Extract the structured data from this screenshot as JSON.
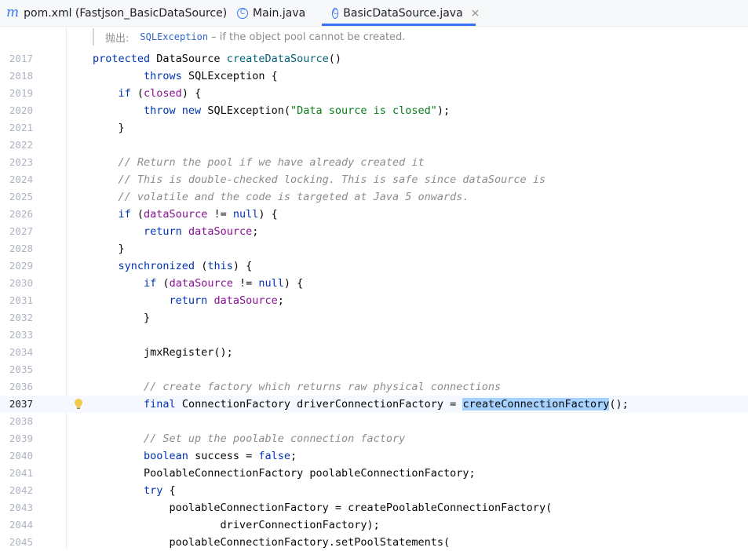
{
  "tabs": [
    {
      "label": "pom.xml (Fastjson_BasicDataSource)",
      "icon": "maven-icon",
      "active": false
    },
    {
      "label": "Main.java",
      "icon": "class-icon",
      "active": false
    },
    {
      "label": "BasicDataSource.java",
      "icon": "class-icon",
      "active": true
    }
  ],
  "close_glyph": "×",
  "doc_hint": {
    "label": "抛出:",
    "link": "SQLException",
    "text": "– if the object pool cannot be created."
  },
  "current_line": "2037",
  "lines": [
    {
      "num": "2017",
      "tokens": [
        [
          "kw",
          "protected"
        ],
        [
          "",
          "DataSource "
        ],
        [
          "mth",
          "createDataSource"
        ],
        [
          "",
          "()"
        ]
      ]
    },
    {
      "num": "2018",
      "tokens": [
        [
          "",
          "        "
        ],
        [
          "kw",
          "throws"
        ],
        [
          "",
          "SQLException {"
        ]
      ]
    },
    {
      "num": "2019",
      "tokens": [
        [
          "",
          "    "
        ],
        [
          "kw",
          "if"
        ],
        [
          "",
          "("
        ],
        [
          "fld",
          "closed"
        ],
        [
          "",
          ") {"
        ]
      ]
    },
    {
      "num": "2020",
      "tokens": [
        [
          "",
          "        "
        ],
        [
          "kw",
          "throw new"
        ],
        [
          "",
          "SQLException("
        ],
        [
          "str",
          "\"Data source is closed\""
        ],
        [
          "",
          ");"
        ]
      ]
    },
    {
      "num": "2021",
      "tokens": [
        [
          "",
          "    }"
        ]
      ]
    },
    {
      "num": "2022",
      "tokens": []
    },
    {
      "num": "2023",
      "tokens": [
        [
          "",
          "    "
        ],
        [
          "cmt",
          "// Return the pool if we have already created it"
        ]
      ]
    },
    {
      "num": "2024",
      "tokens": [
        [
          "",
          "    "
        ],
        [
          "cmt",
          "// This is double-checked locking. This is safe since dataSource is"
        ]
      ]
    },
    {
      "num": "2025",
      "tokens": [
        [
          "",
          "    "
        ],
        [
          "cmt",
          "// volatile and the code is targeted at Java 5 onwards."
        ]
      ]
    },
    {
      "num": "2026",
      "tokens": [
        [
          "",
          "    "
        ],
        [
          "kw",
          "if"
        ],
        [
          "",
          "("
        ],
        [
          "fld",
          "dataSource"
        ],
        [
          "",
          " != "
        ],
        [
          "kw",
          "null"
        ],
        [
          "",
          ") {"
        ]
      ]
    },
    {
      "num": "2027",
      "tokens": [
        [
          "",
          "        "
        ],
        [
          "kw",
          "return"
        ],
        [
          "fld",
          "dataSource"
        ],
        [
          "",
          ";"
        ]
      ]
    },
    {
      "num": "2028",
      "tokens": [
        [
          "",
          "    }"
        ]
      ]
    },
    {
      "num": "2029",
      "tokens": [
        [
          "",
          "    "
        ],
        [
          "kw",
          "synchronized"
        ],
        [
          "",
          "("
        ],
        [
          "kw",
          "this"
        ],
        [
          "",
          ") {"
        ]
      ]
    },
    {
      "num": "2030",
      "tokens": [
        [
          "",
          "        "
        ],
        [
          "kw",
          "if"
        ],
        [
          "",
          "("
        ],
        [
          "fld",
          "dataSource"
        ],
        [
          "",
          " != "
        ],
        [
          "kw",
          "null"
        ],
        [
          "",
          ") {"
        ]
      ]
    },
    {
      "num": "2031",
      "tokens": [
        [
          "",
          "            "
        ],
        [
          "kw",
          "return"
        ],
        [
          "fld",
          "dataSource"
        ],
        [
          "",
          ";"
        ]
      ]
    },
    {
      "num": "2032",
      "tokens": [
        [
          "",
          "        }"
        ]
      ]
    },
    {
      "num": "2033",
      "tokens": []
    },
    {
      "num": "2034",
      "tokens": [
        [
          "",
          "        jmxRegister();"
        ]
      ]
    },
    {
      "num": "2035",
      "tokens": []
    },
    {
      "num": "2036",
      "tokens": [
        [
          "",
          "        "
        ],
        [
          "cmt",
          "// create factory which returns raw physical connections"
        ]
      ]
    },
    {
      "num": "2037",
      "tokens": [
        [
          "",
          "        "
        ],
        [
          "kw",
          "final"
        ],
        [
          "",
          "ConnectionFactory driverConnectionFactory = "
        ],
        [
          "sel",
          "createConnectionFactory"
        ],
        [
          "",
          "();"
        ]
      ]
    },
    {
      "num": "2038",
      "tokens": []
    },
    {
      "num": "2039",
      "tokens": [
        [
          "",
          "        "
        ],
        [
          "cmt",
          "// Set up the poolable connection factory"
        ]
      ]
    },
    {
      "num": "2040",
      "tokens": [
        [
          "",
          "        "
        ],
        [
          "kw",
          "boolean"
        ],
        [
          "",
          "success = "
        ],
        [
          "kw",
          "false"
        ],
        [
          "",
          ";"
        ]
      ]
    },
    {
      "num": "2041",
      "tokens": [
        [
          "",
          "        PoolableConnectionFactory poolableConnectionFactory;"
        ]
      ]
    },
    {
      "num": "2042",
      "tokens": [
        [
          "",
          "        "
        ],
        [
          "kw",
          "try"
        ],
        [
          "",
          "{"
        ]
      ]
    },
    {
      "num": "2043",
      "tokens": [
        [
          "",
          "            poolableConnectionFactory = createPoolableConnectionFactory("
        ]
      ]
    },
    {
      "num": "2044",
      "tokens": [
        [
          "",
          "                    driverConnectionFactory);"
        ]
      ]
    },
    {
      "num": "2045",
      "tokens": [
        [
          "",
          "            poolableConnectionFactory.setPoolStatements("
        ]
      ]
    }
  ]
}
